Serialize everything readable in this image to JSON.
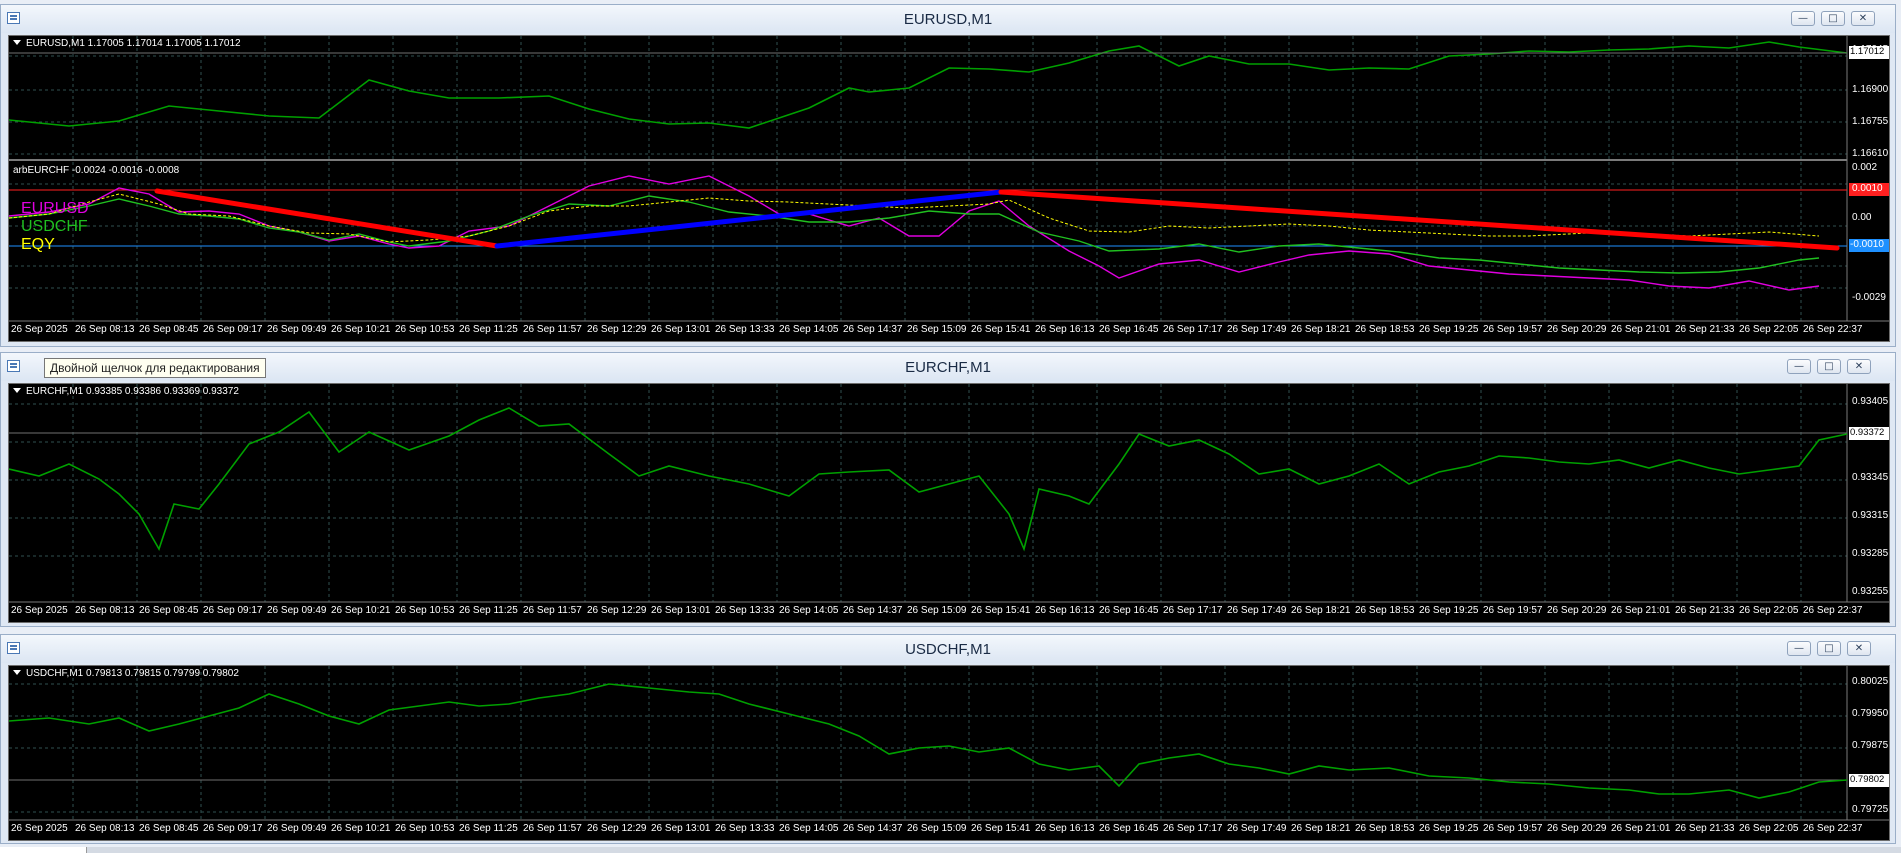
{
  "windows": [
    {
      "title": "EURUSD,M1",
      "panes": [
        {
          "info": "EURUSD,M1  1.17005 1.17014 1.17005 1.17012",
          "price_labels": [
            "1.17045",
            "1.16900",
            "1.16755",
            "1.16610"
          ],
          "current_price": "1.17012"
        },
        {
          "info": "arbEURCHF -0.0024 -0.0016 -0.0008",
          "price_labels": [
            "0.002",
            "0.00",
            "-0.0029"
          ],
          "levels": {
            "upper": "0.0010",
            "lower": "-0.0010"
          },
          "legend": [
            {
              "label": "EURUSD",
              "color": "#e000e0"
            },
            {
              "label": "USDCHF",
              "color": "#20c020"
            },
            {
              "label": "EQY",
              "color": "#ffff00"
            }
          ]
        }
      ]
    },
    {
      "title": "EURCHF,M1",
      "panes": [
        {
          "info": "EURCHF,M1  0.93385 0.93386 0.93369 0.93372",
          "price_labels": [
            "0.93405",
            "0.93375",
            "0.93345",
            "0.93315",
            "0.93285",
            "0.93255"
          ],
          "current_price": "0.93372"
        }
      ]
    },
    {
      "title": "USDCHF,M1",
      "panes": [
        {
          "info": "USDCHF,M1  0.79813 0.79815 0.79799 0.79802",
          "price_labels": [
            "0.80025",
            "0.79950",
            "0.79875",
            "0.79725"
          ],
          "current_price": "0.79802"
        }
      ]
    }
  ],
  "time_labels": [
    "26 Sep 2025",
    "26 Sep 08:13",
    "26 Sep 08:45",
    "26 Sep 09:17",
    "26 Sep 09:49",
    "26 Sep 10:21",
    "26 Sep 10:53",
    "26 Sep 11:25",
    "26 Sep 11:57",
    "26 Sep 12:29",
    "26 Sep 13:01",
    "26 Sep 13:33",
    "26 Sep 14:05",
    "26 Sep 14:37",
    "26 Sep 15:09",
    "26 Sep 15:41",
    "26 Sep 16:13",
    "26 Sep 16:45",
    "26 Sep 17:17",
    "26 Sep 17:49",
    "26 Sep 18:21",
    "26 Sep 18:53",
    "26 Sep 19:25",
    "26 Sep 19:57",
    "26 Sep 20:29",
    "26 Sep 21:01",
    "26 Sep 21:33",
    "26 Sep 22:05",
    "26 Sep 22:37"
  ],
  "tooltip": "Двойной щелчок для редактирования",
  "window_buttons": {
    "minimize": "—",
    "maximize": "□",
    "close": "✕"
  },
  "colors": {
    "chart_bg": "#000000",
    "grid": "#2f4f4f",
    "price_line": "#00a000",
    "current_marker": "#ffffff",
    "level_upper": "#ff2020",
    "level_lower": "#1e90ff",
    "arrow_red": "#ff0000",
    "arrow_blue": "#0000ff"
  }
}
